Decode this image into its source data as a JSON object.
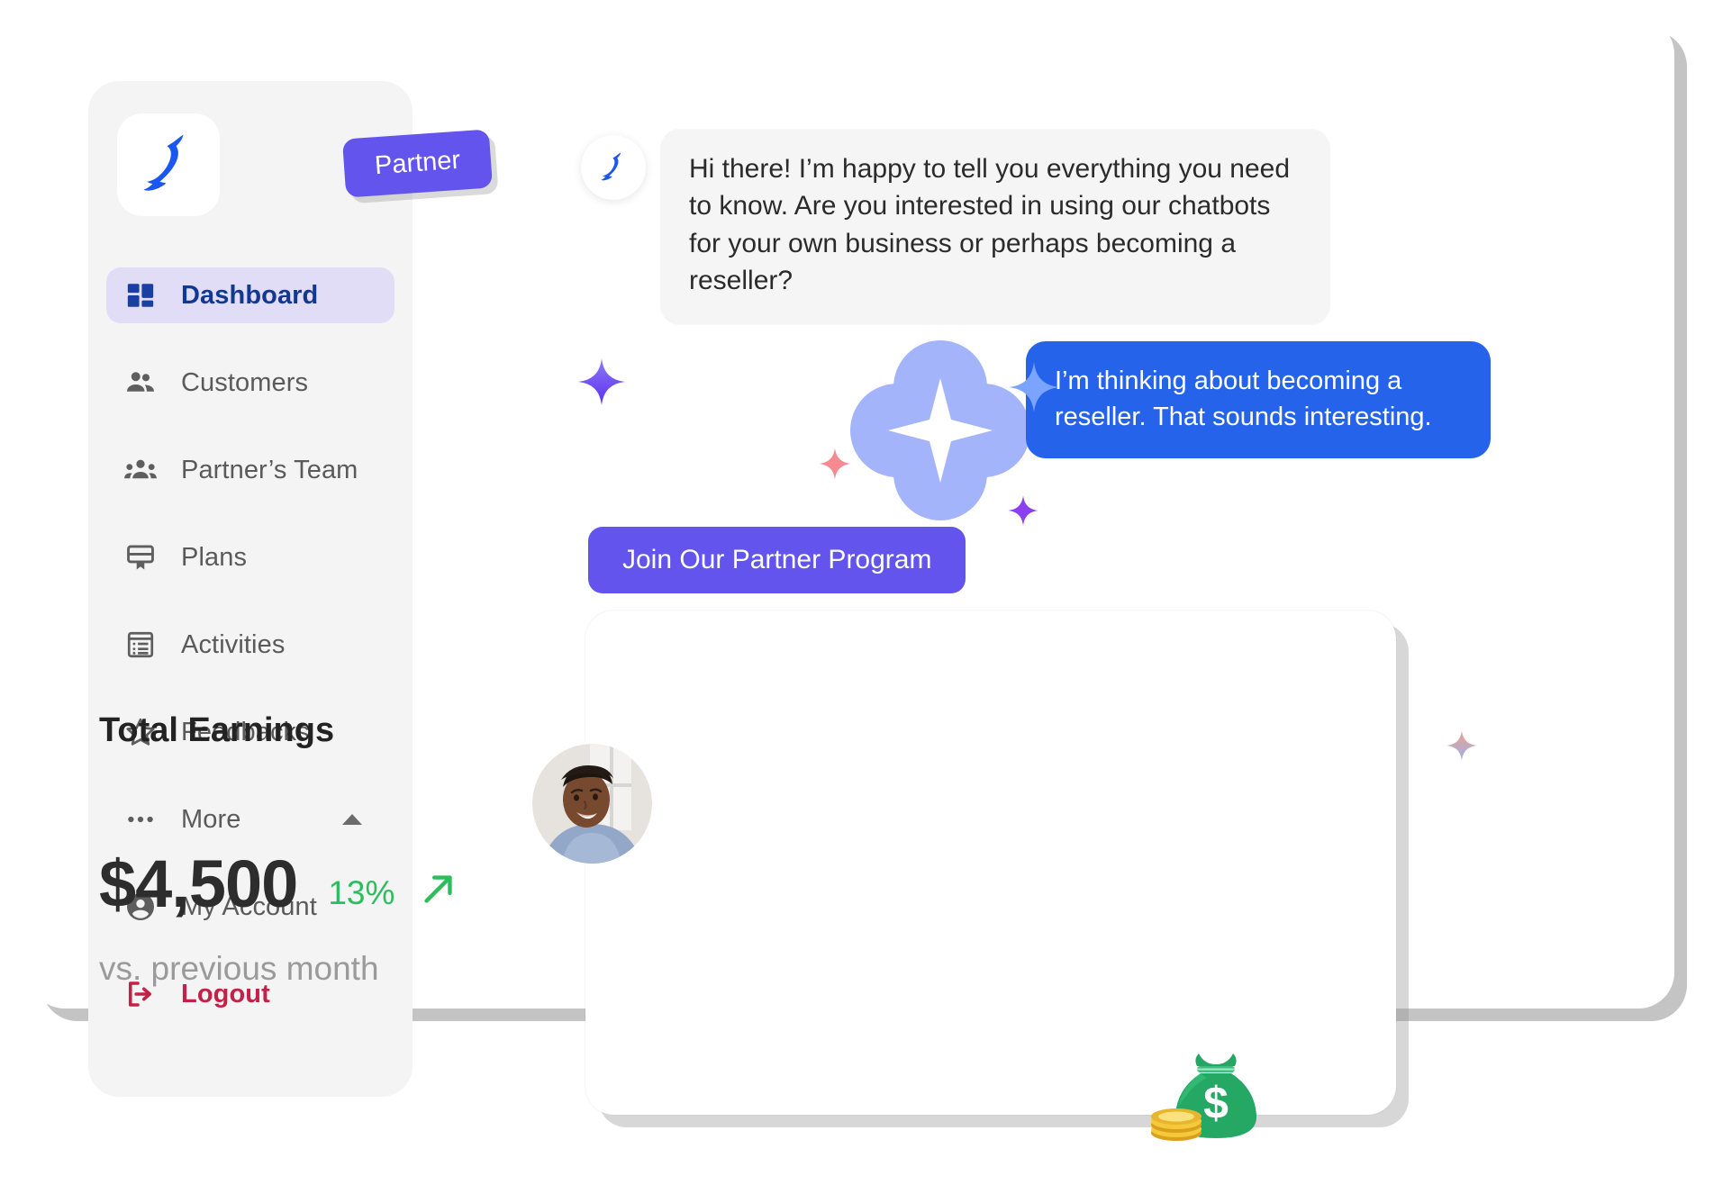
{
  "brand": {
    "logo_icon": "penguin-logo-icon",
    "logo_color": "#1a56f0",
    "accent_purple": "#6254ec",
    "accent_blue": "#2563eb",
    "danger_red": "#c32148",
    "success_green": "#2ebd5e"
  },
  "badge": {
    "label": "Partner"
  },
  "sidebar": {
    "items": [
      {
        "label": "Dashboard",
        "icon": "dashboard-grid-icon",
        "active": true
      },
      {
        "label": "Customers",
        "icon": "people-icon",
        "active": false
      },
      {
        "label": "Partner’s Team",
        "icon": "group-people-icon",
        "active": false
      },
      {
        "label": "Plans",
        "icon": "plans-card-icon",
        "active": false
      },
      {
        "label": "Activities",
        "icon": "list-activities-icon",
        "active": false
      },
      {
        "label": "Feedbacks",
        "icon": "star-outline-icon",
        "active": false
      },
      {
        "label": "More",
        "icon": "ellipsis-icon",
        "active": false,
        "expander": "chevron-up-icon"
      },
      {
        "label": "My Account",
        "icon": "account-circle-icon",
        "active": false
      },
      {
        "label": "Logout",
        "icon": "logout-arrow-icon",
        "active": false,
        "danger": true
      }
    ]
  },
  "chat": {
    "bot_avatar_icon": "penguin-logo-icon",
    "messages": [
      {
        "sender": "bot",
        "text": "Hi there! I’m happy to tell you everything you need to know.  Are you interested in using our chatbots for your own business or perhaps becoming a reseller?"
      },
      {
        "sender": "user",
        "text": "I’m thinking about becoming a reseller. That sounds interesting."
      }
    ],
    "cta_label": "Join Our Partner Program"
  },
  "earnings_card": {
    "title": "Total Earnings",
    "value": "$4,500",
    "change_percent": "13%",
    "change_direction": "up",
    "comparison_label": "vs. previous month",
    "avatar_icon": "user-photo-avatar",
    "money_icon": "money-bag-icon"
  },
  "decorations": {
    "sparkles": [
      {
        "name": "sparkle-violet",
        "color": "#6a3ff0"
      },
      {
        "name": "sparkle-pink",
        "color": "#f58a90"
      },
      {
        "name": "sparkle-purple",
        "color": "#8b3ff0"
      },
      {
        "name": "sparkle-blue",
        "color": "#8fb0ff"
      },
      {
        "name": "sparkle-gradient",
        "color": "#f0a080"
      }
    ],
    "clover": {
      "name": "ai-clover-shape",
      "color": "#a3b4fb"
    }
  }
}
